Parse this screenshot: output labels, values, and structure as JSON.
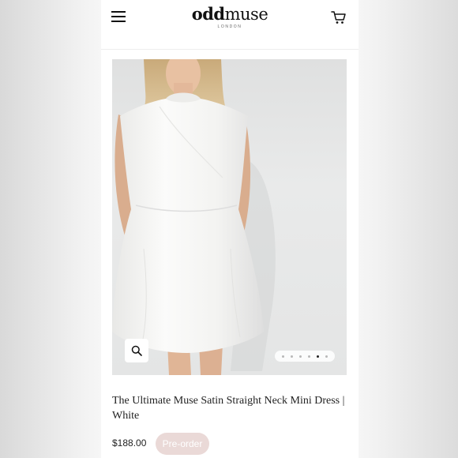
{
  "header": {
    "menu_icon": "hamburger-menu-icon",
    "logo_bold": "odd",
    "logo_light": "muse",
    "logo_sub": "LONDON",
    "cart_icon": "shopping-cart-icon"
  },
  "gallery": {
    "zoom_icon": "magnifier-icon",
    "dot_count": 6,
    "active_dot": 5
  },
  "product": {
    "title": "The Ultimate Muse Satin Straight Neck Mini Dress | White",
    "price": "$188.00",
    "preorder_label": "Pre-order"
  },
  "colors": {
    "preorder_bg": "#ead9d7",
    "dress": "#f7f7f5",
    "background": "#eaeaea"
  }
}
